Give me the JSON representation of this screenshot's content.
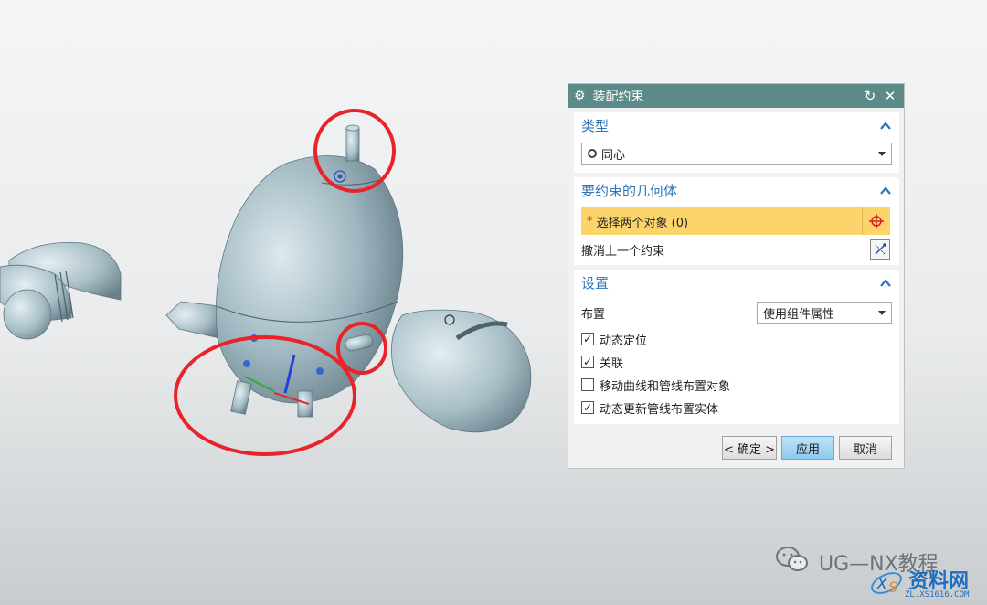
{
  "dialog": {
    "title": "装配约束",
    "type_section": {
      "heading": "类型",
      "selected": "同心"
    },
    "geometry_section": {
      "heading": "要约束的几何体",
      "select_label": "选择两个对象 (0)",
      "undo_label": "撤消上一个约束"
    },
    "settings_section": {
      "heading": "设置",
      "layout_label": "布置",
      "layout_value": "使用组件属性",
      "options": [
        {
          "label": "动态定位",
          "checked": true
        },
        {
          "label": "关联",
          "checked": true
        },
        {
          "label": "移动曲线和管线布置对象",
          "checked": false
        },
        {
          "label": "动态更新管线布置实体",
          "checked": true
        }
      ]
    },
    "buttons": {
      "ok": "< 确定 >",
      "apply": "应用",
      "cancel": "取消"
    }
  },
  "watermark": {
    "channel": "UG—NX教程",
    "site": "资料网",
    "site_url": "ZL.XS1616.COM"
  },
  "colors": {
    "titlebar": "#5b8a87",
    "heading": "#2f76b6",
    "highlight_row": "#fbd46b",
    "annotation": "#e8242a",
    "model": "#8fa9b3"
  }
}
